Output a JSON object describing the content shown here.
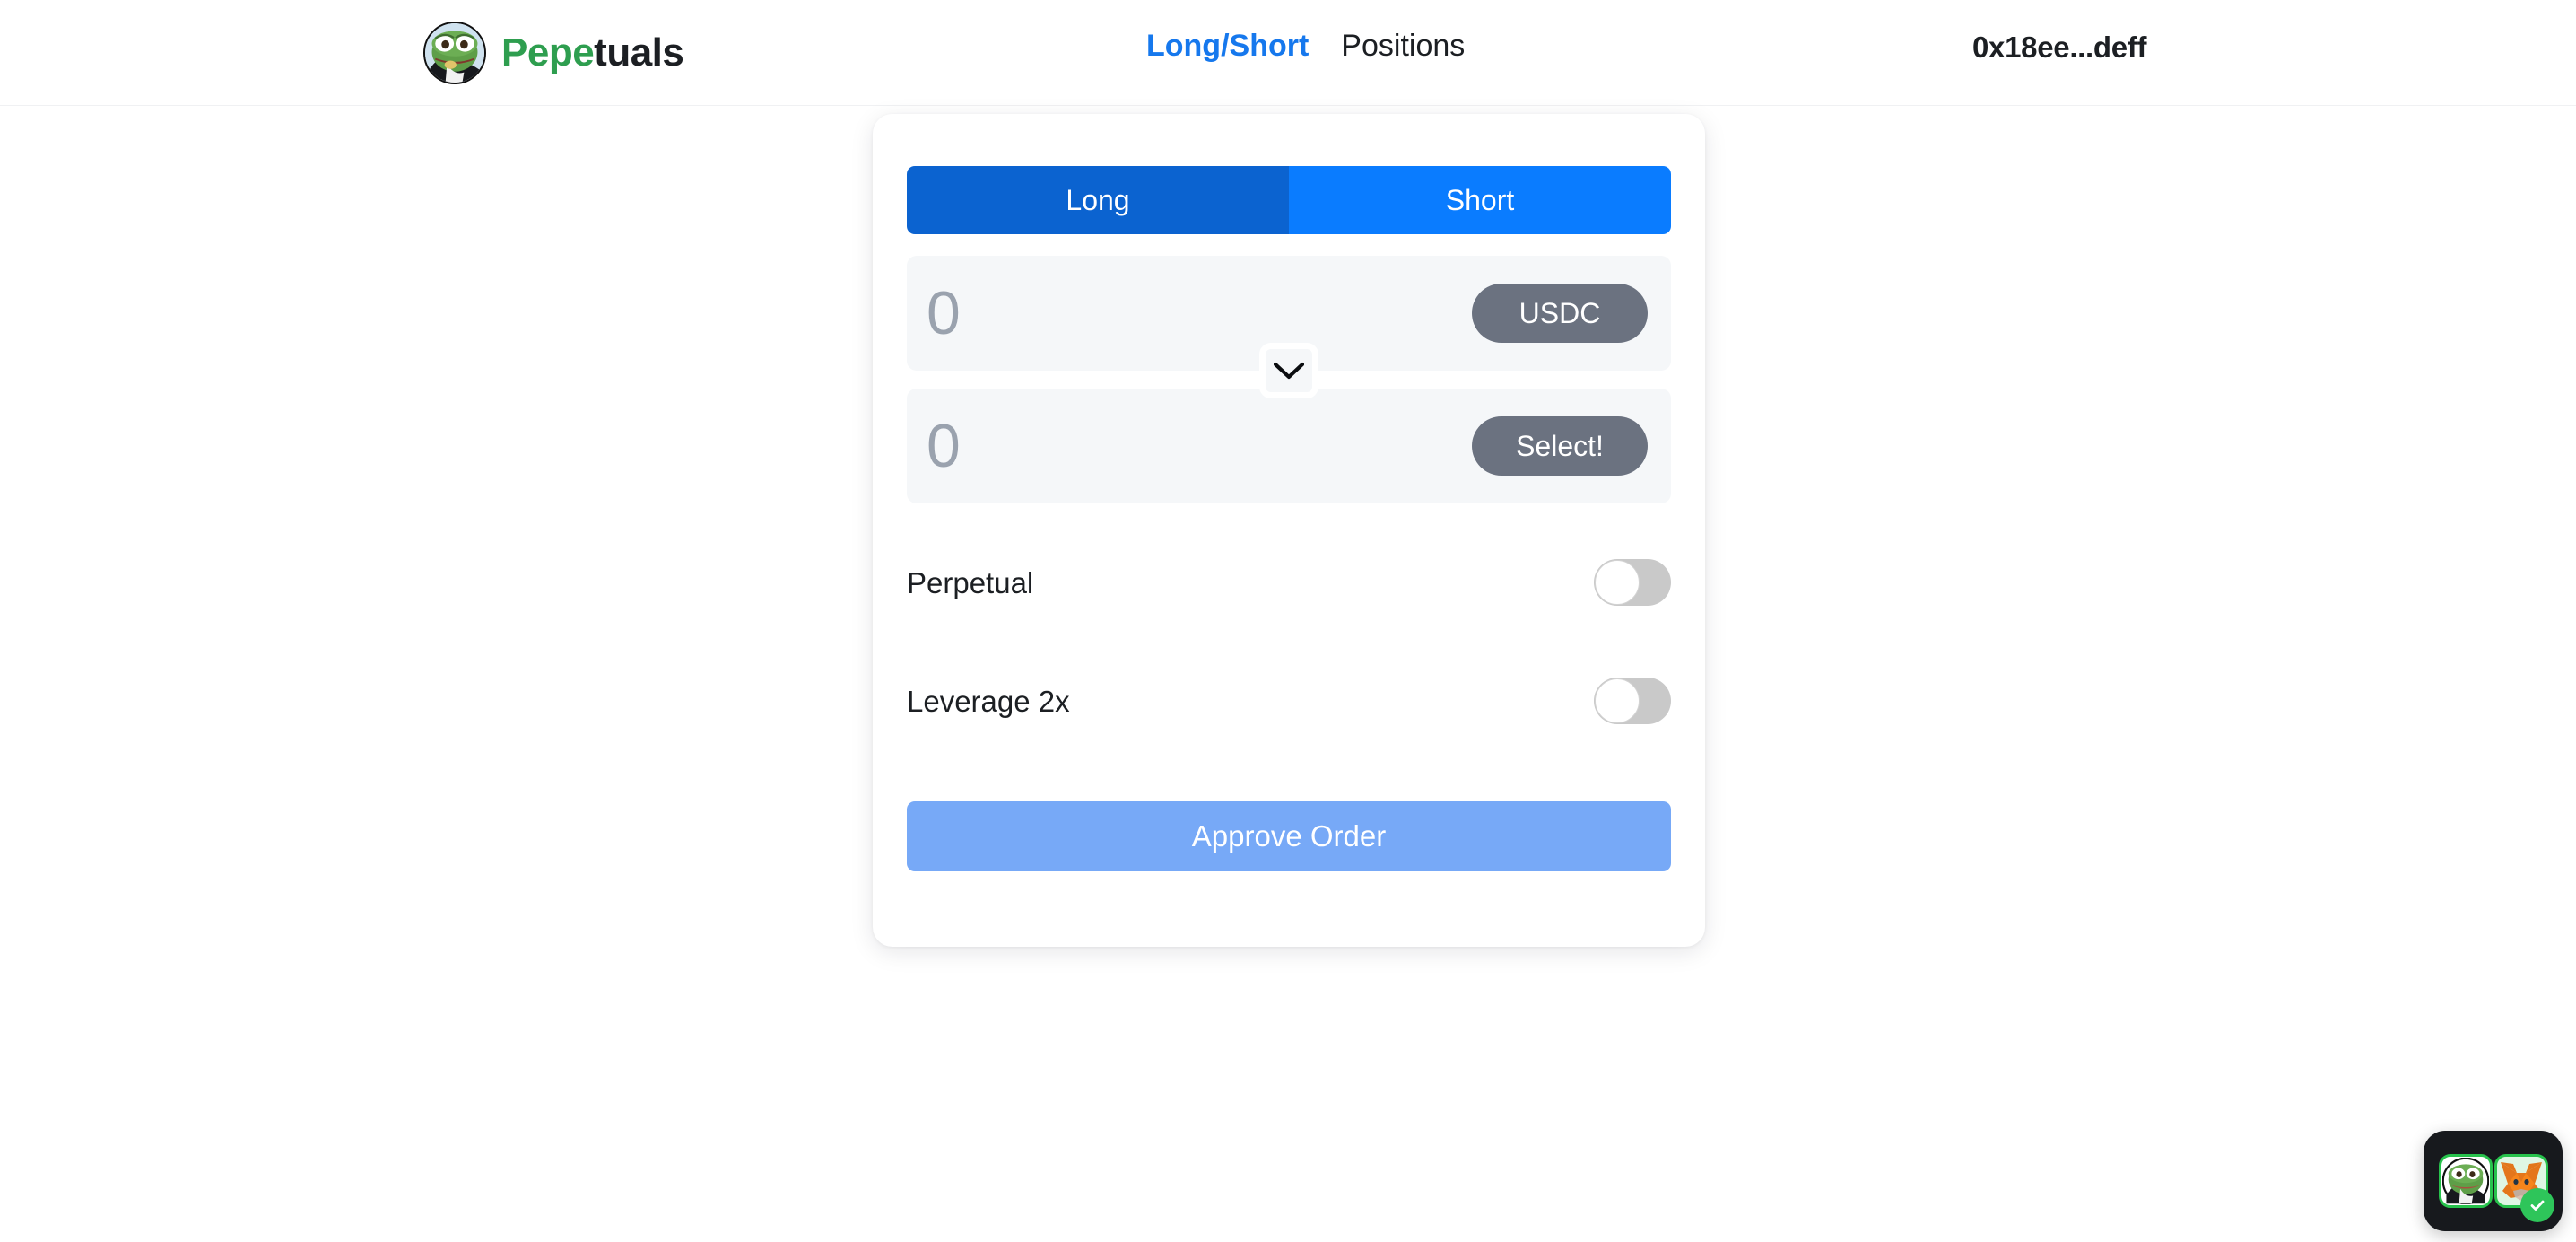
{
  "header": {
    "brand": {
      "name_accent": "Pepe",
      "name_rest": "tuals",
      "avatar_icon": "pepe-avatar-icon"
    },
    "nav": [
      {
        "label": "Long/Short",
        "active": true
      },
      {
        "label": "Positions",
        "active": false
      }
    ],
    "wallet_address": "0x18ee...deff"
  },
  "card": {
    "side_toggle": {
      "long_label": "Long",
      "short_label": "Short",
      "long_color": "#0b63d0",
      "short_color": "#0a7cff",
      "selected": "Short"
    },
    "pay_row": {
      "amount": "0",
      "amount_placeholder": "0",
      "token_label": "USDC"
    },
    "swap_icon": "chevron-down-icon",
    "receive_row": {
      "amount": "0",
      "amount_placeholder": "0",
      "token_label": "Select!"
    },
    "options": [
      {
        "label": "Perpetual",
        "enabled": false
      },
      {
        "label": "Leverage 2x",
        "enabled": false
      }
    ],
    "submit": {
      "label": "Approve Order",
      "color": "#77a9f7",
      "disabled": true
    }
  },
  "wallet_widget": {
    "site_icon": "pepe-avatar-icon",
    "wallet_icon": "metamask-fox-icon",
    "status_icon": "check-circle-icon",
    "status_color": "#2ec55a"
  }
}
